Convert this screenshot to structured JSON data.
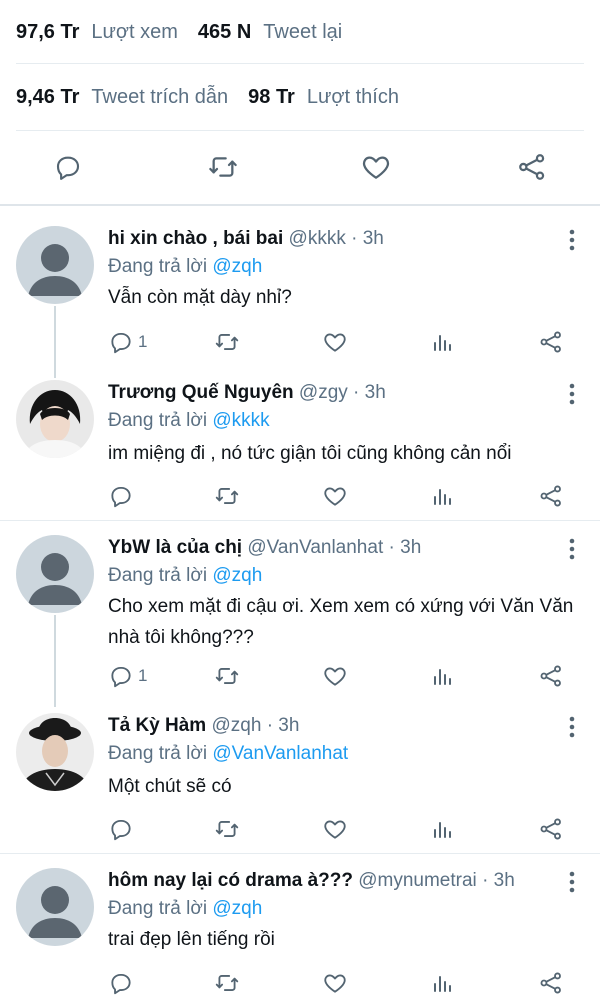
{
  "stats": {
    "views_value": "97,6 Tr",
    "views_label": "Lượt xem",
    "retweets_value": "465 N",
    "retweets_label": "Tweet lại",
    "quotes_value": "9,46 Tr",
    "quotes_label": "Tweet trích dẫn",
    "likes_value": "98 Tr",
    "likes_label": "Lượt thích"
  },
  "replies": [
    {
      "name": "hi xin chào , bái bai",
      "handle": "@kkkk",
      "time": "· 3h",
      "replying_label": "Đang trả lời",
      "replying_to": "@zqh",
      "text": "Vẫn còn mặt dày nhỉ?",
      "reply_count": "1",
      "avatar": "default"
    },
    {
      "name": "Trương Quế Nguyên",
      "handle": "@zgy",
      "time": "· 3h",
      "replying_label": "Đang trả lời",
      "replying_to": "@kkkk",
      "text": "im miệng đi , nó tức giận tôi cũng không cản nổi",
      "reply_count": "",
      "avatar": "photo"
    },
    {
      "name": "YbW là của chị",
      "handle": "@VanVanlanhat",
      "time": "· 3h",
      "replying_label": "Đang trả lời",
      "replying_to": "@zqh",
      "text": "Cho xem mặt đi cậu ơi. Xem xem có xứng với Văn Văn nhà tôi không???",
      "reply_count": "1",
      "avatar": "default"
    },
    {
      "name": "Tả Kỳ Hàm",
      "handle": "@zqh",
      "time": "· 3h",
      "replying_label": "Đang trả lời",
      "replying_to": "@VanVanlanhat",
      "text": "Một chút sẽ có",
      "reply_count": "",
      "avatar": "photo"
    },
    {
      "name": "hôm nay lại có drama à???",
      "handle": "@mynumetrai",
      "time": "· 3h",
      "replying_label": "Đang trả lời",
      "replying_to": "@zqh",
      "text": "trai đẹp lên tiếng rồi",
      "reply_count": "",
      "avatar": "default"
    }
  ]
}
